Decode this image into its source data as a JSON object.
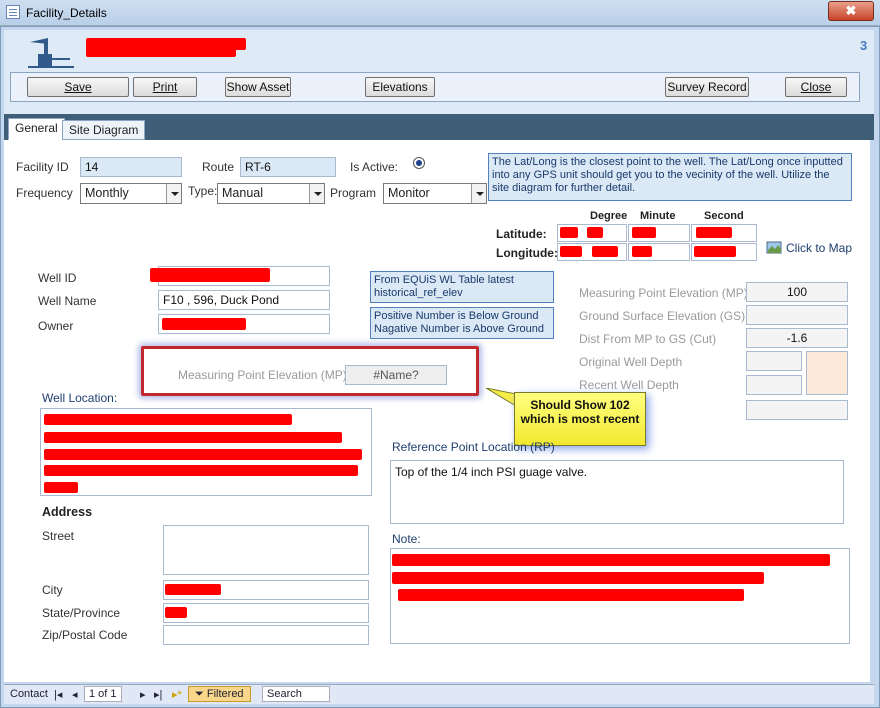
{
  "window": {
    "title": "Facility_Details",
    "close_glyph": "✖"
  },
  "header": {
    "page_number": "3"
  },
  "toolbar": {
    "save": "Save",
    "print": "Print",
    "show_asset": "Show Asset",
    "elevations": "Elevations",
    "survey_record": "Survey Record",
    "close": "Close"
  },
  "tabs": {
    "general": "General",
    "site_diagram": "Site Diagram"
  },
  "form": {
    "facility_id_label": "Facility ID",
    "facility_id": "14",
    "route_label": "Route",
    "route": "RT-6",
    "is_active_label": "Is Active:",
    "frequency_label": "Frequency",
    "frequency": "Monthly",
    "type_label": "Type:",
    "type": "Manual",
    "program_label": "Program",
    "program": "Monitor",
    "latlong_note": "The Lat/Long is the closest point to the well.  The Lat/Long once inputted into any GPS unit should get you to the vecinity of the well. Utilize the site diagram for further detail.",
    "degree": "Degree",
    "minute": "Minute",
    "second": "Second",
    "latitude_label": "Latitude:",
    "longitude_label": "Longitude:",
    "click_to_map": "Click to Map",
    "well_id_label": "Well ID",
    "well_name_label": "Well Name",
    "well_name": "F10 , 596, Duck Pond",
    "owner_label": "Owner",
    "equis_note": "From EQUiS WL Table latest historical_ref_elev",
    "sign_note": "Positive Number is Below Ground Nagative Number is Above Ground",
    "mp_label": "Measuring Point Elevation (MP)",
    "mp_value": "100",
    "gs_label": "Ground Surface Elevation (GS)",
    "cut_label": "Dist From MP to GS (Cut)",
    "cut_value": "-1.6",
    "orig_depth_label": "Original Well Depth",
    "recent_depth_label": "Recent Well Depth",
    "mp_inner_label": "Measuring Point Elevation (MP)",
    "mp_inner_value": "#Name?",
    "callout": "Should Show 102 which is most recent",
    "well_location_label": "Well Location:",
    "ref_point_label": "Reference Point Location (RP)",
    "ref_point_value": "Top of the 1/4 inch PSI guage valve.",
    "address_label": "Address",
    "street_label": "Street",
    "city_label": "City",
    "state_label": "State/Province",
    "zip_label": "Zip/Postal Code",
    "note_label": "Note:"
  },
  "status": {
    "record_label": "Contact",
    "record": "1 of 1",
    "filtered": "Filtered",
    "search": "Search"
  },
  "colors": {
    "accent": "#3f5f78",
    "redaction": "#ff0000",
    "callout": "#ffff66"
  }
}
